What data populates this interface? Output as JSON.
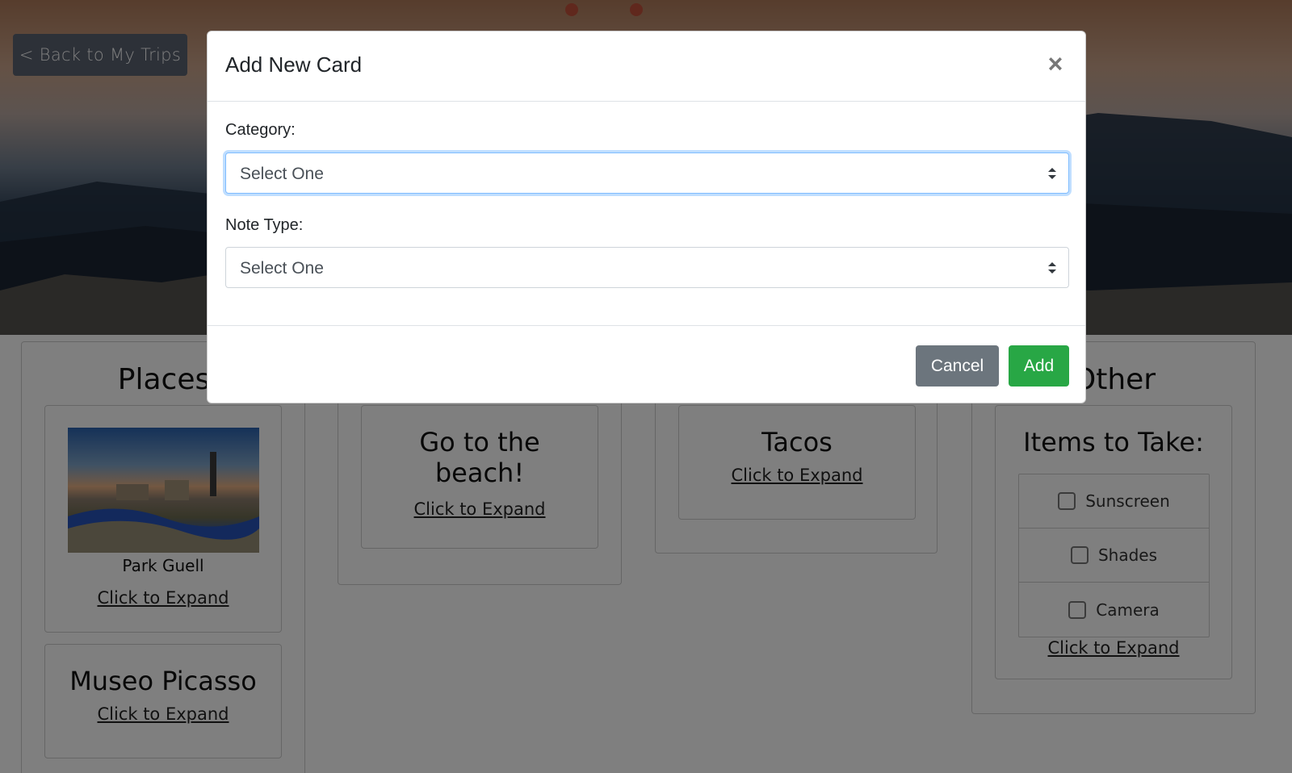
{
  "page": {
    "back_label": "< Back to My Trips"
  },
  "columns": {
    "places": {
      "title": "Places",
      "cards": [
        {
          "caption": "Park Guell",
          "expand_label": "Click to Expand"
        },
        {
          "title": "Museo Picasso",
          "expand_label": "Click to Expand"
        }
      ]
    },
    "activities": {
      "cards": [
        {
          "title": "Go to the beach!",
          "expand_label": "Click to Expand"
        }
      ]
    },
    "food": {
      "cards": [
        {
          "title": "Tacos",
          "expand_label": "Click to Expand"
        }
      ]
    },
    "other": {
      "title_visible": "Other",
      "cards": [
        {
          "title": "Items to Take:",
          "items": [
            "Sunscreen",
            "Shades",
            "Camera"
          ],
          "expand_label": "Click to Expand"
        }
      ]
    }
  },
  "modal": {
    "title": "Add New Card",
    "close_glyph": "×",
    "category": {
      "label": "Category:",
      "value": "Select One"
    },
    "note_type": {
      "label": "Note Type:",
      "value": "Select One"
    },
    "cancel_label": "Cancel",
    "add_label": "Add"
  },
  "colors": {
    "cancel": "#6c757d",
    "add": "#28a745",
    "focus_ring": "#80bdff"
  }
}
